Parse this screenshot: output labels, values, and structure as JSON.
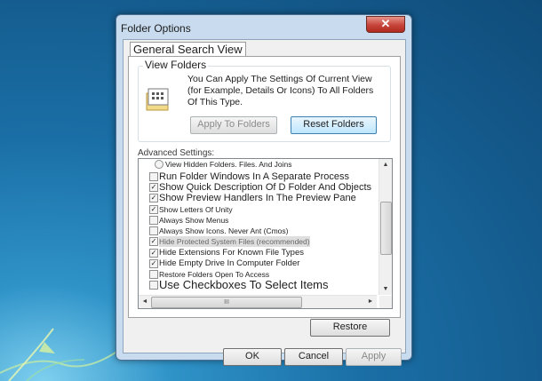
{
  "window": {
    "title": "Folder Options",
    "close_glyph": "✕"
  },
  "tabs": {
    "label": "General Search View"
  },
  "view_folders": {
    "legend": "View Folders",
    "description": "You Can Apply The Settings Of Current View (for Example, Details Or Icons) To All Folders Of This Type.",
    "apply_button": "Apply To Folders",
    "reset_button": "Reset Folders"
  },
  "advanced": {
    "label": "Advanced Settings:",
    "items": [
      {
        "text": "View Hidden Folders. Files. And Joins",
        "control": "radio",
        "checked": false
      },
      {
        "text": "Run Folder Windows In A Separate Process",
        "control": "checkbox",
        "checked": false
      },
      {
        "text": "Show Quick Description Of D Folder And Objects",
        "control": "checkbox",
        "checked": true
      },
      {
        "text": "Show Preview Handlers In The Preview Pane",
        "control": "checkbox",
        "checked": true
      },
      {
        "text": "Show Letters Of Unity",
        "control": "checkbox",
        "checked": true
      },
      {
        "text": "Always Show Menus",
        "control": "checkbox",
        "checked": false
      },
      {
        "text": "Always Show Icons. Never Ant (Cmos)",
        "control": "checkbox",
        "checked": false
      },
      {
        "text": "Hide Protected System Files (recommended)",
        "control": "checkbox",
        "checked": true,
        "selected": true
      },
      {
        "text": "Hide Extensions For Known File Types",
        "control": "checkbox",
        "checked": true
      },
      {
        "text": "Hide Empty Drive In Computer Folder",
        "control": "checkbox",
        "checked": true
      },
      {
        "text": "Restore Folders Open To Access",
        "control": "checkbox",
        "checked": false
      },
      {
        "text": "Use Checkboxes To Select Items",
        "control": "checkbox",
        "checked": false
      }
    ]
  },
  "scroll": {
    "hthumb_grip": "III",
    "up": "▲",
    "down": "▼",
    "left": "◄",
    "right": "►"
  },
  "buttons": {
    "restore": "Restore",
    "ok": "OK",
    "cancel": "Cancel",
    "apply": "Apply"
  },
  "colors": {
    "selection": "#dedede",
    "title_bar": "#c9dcef",
    "close": "#c7443a"
  }
}
